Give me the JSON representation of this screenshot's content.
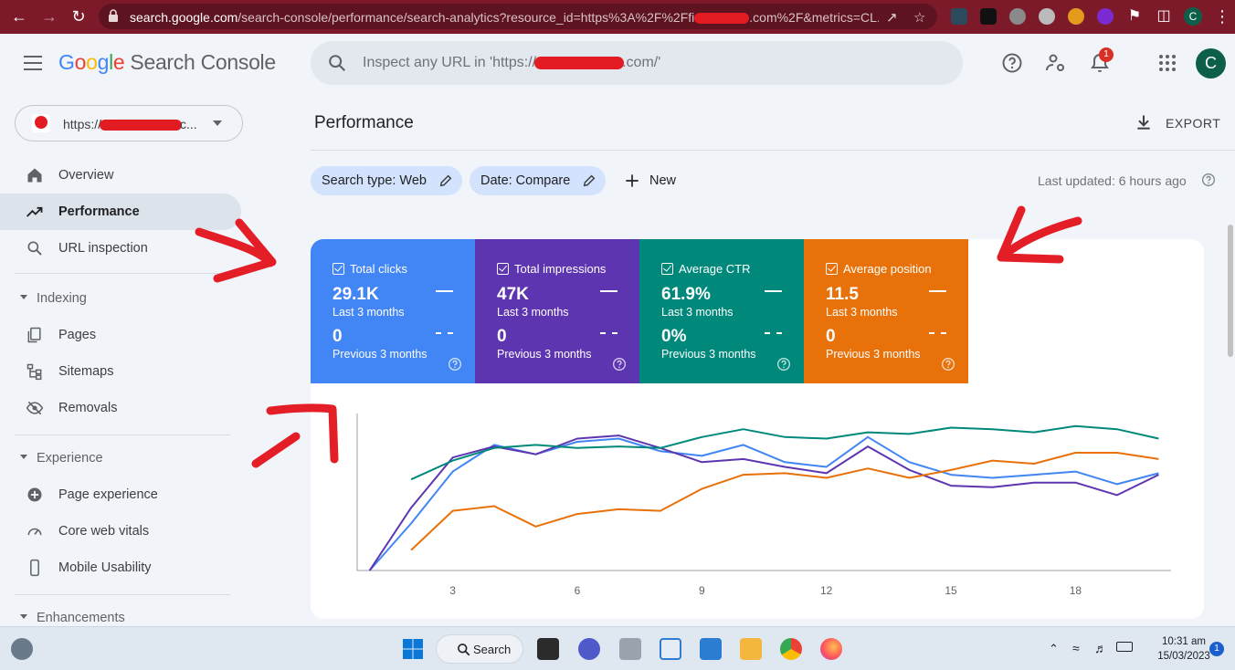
{
  "browser": {
    "url_domain": "search.google.com",
    "url_path": "/search-console/performance/search-analytics?resource_id=https%3A%2F%2Ffi",
    "url_tail": ".com%2F&metrics=CL...",
    "tab_avatar": "C"
  },
  "header": {
    "logo_google": "Google",
    "logo_product": "Search Console",
    "search_placeholder": "Inspect any URL in 'https://",
    "search_placeholder_tail": ".com/'",
    "notification_count": "1",
    "avatar_letter": "C"
  },
  "sidebar": {
    "property_label": "https://",
    "property_tail": "c...",
    "items": [
      {
        "label": "Overview",
        "icon": "home-icon"
      },
      {
        "label": "Performance",
        "icon": "trending-up-icon",
        "active": true
      },
      {
        "label": "URL inspection",
        "icon": "search-icon"
      }
    ],
    "sections": [
      {
        "label": "Indexing",
        "items": [
          {
            "label": "Pages",
            "icon": "pages-icon"
          },
          {
            "label": "Sitemaps",
            "icon": "sitemap-icon"
          },
          {
            "label": "Removals",
            "icon": "eye-off-icon"
          }
        ]
      },
      {
        "label": "Experience",
        "items": [
          {
            "label": "Page experience",
            "icon": "plus-circle-icon"
          },
          {
            "label": "Core web vitals",
            "icon": "gauge-icon"
          },
          {
            "label": "Mobile Usability",
            "icon": "phone-icon"
          }
        ]
      },
      {
        "label": "Enhancements",
        "items": []
      }
    ]
  },
  "main": {
    "title": "Performance",
    "export_label": "EXPORT",
    "filters": [
      {
        "label": "Search type: Web"
      },
      {
        "label": "Date: Compare"
      }
    ],
    "new_label": "New",
    "last_updated": "Last updated: 6 hours ago"
  },
  "metrics": [
    {
      "name": "Total clicks",
      "value": "29.1K",
      "period": "Last 3 months",
      "prev_value": "0",
      "prev_period": "Previous 3 months",
      "color": "#4285f4"
    },
    {
      "name": "Total impressions",
      "value": "47K",
      "period": "Last 3 months",
      "prev_value": "0",
      "prev_period": "Previous 3 months",
      "color": "#5e35b1"
    },
    {
      "name": "Average CTR",
      "value": "61.9%",
      "period": "Last 3 months",
      "prev_value": "0%",
      "prev_period": "Previous 3 months",
      "color": "#00897b"
    },
    {
      "name": "Average position",
      "value": "11.5",
      "period": "Last 3 months",
      "prev_value": "0",
      "prev_period": "Previous 3 months",
      "color": "#e8710a"
    }
  ],
  "chart_data": {
    "type": "line",
    "x": [
      1,
      2,
      3,
      4,
      5,
      6,
      7,
      8,
      9,
      10,
      11,
      12,
      13,
      14,
      15,
      16,
      17,
      18,
      19,
      20
    ],
    "xticks": [
      3,
      6,
      9,
      12,
      15,
      18
    ],
    "xlim": [
      0.7,
      20.3
    ],
    "ylim": [
      0,
      100
    ],
    "grid": false,
    "series": [
      {
        "color": "#4285f4",
        "values": [
          0,
          30,
          63,
          80,
          74,
          82,
          84,
          76,
          73,
          80,
          69,
          66,
          85,
          69,
          61,
          59,
          61,
          63,
          55,
          62
        ]
      },
      {
        "color": "#5e35b1",
        "values": [
          0,
          40,
          72,
          79,
          74,
          84,
          86,
          78,
          69,
          71,
          66,
          62,
          79,
          64,
          54,
          53,
          56,
          56,
          48,
          61
        ]
      },
      {
        "color": "#00897b",
        "values": [
          null,
          58,
          70,
          78,
          80,
          78,
          79,
          78,
          85,
          90,
          85,
          84,
          88,
          87,
          91,
          90,
          88,
          92,
          90,
          84
        ]
      },
      {
        "color": "#e8710a",
        "values": [
          null,
          13,
          38,
          41,
          28,
          36,
          39,
          38,
          52,
          61,
          62,
          59,
          65,
          59,
          64,
          70,
          68,
          75,
          75,
          71
        ]
      }
    ]
  },
  "taskbar": {
    "search_label": "Search",
    "time": "10:31 am",
    "date": "15/03/2023",
    "notification_count": "1"
  }
}
